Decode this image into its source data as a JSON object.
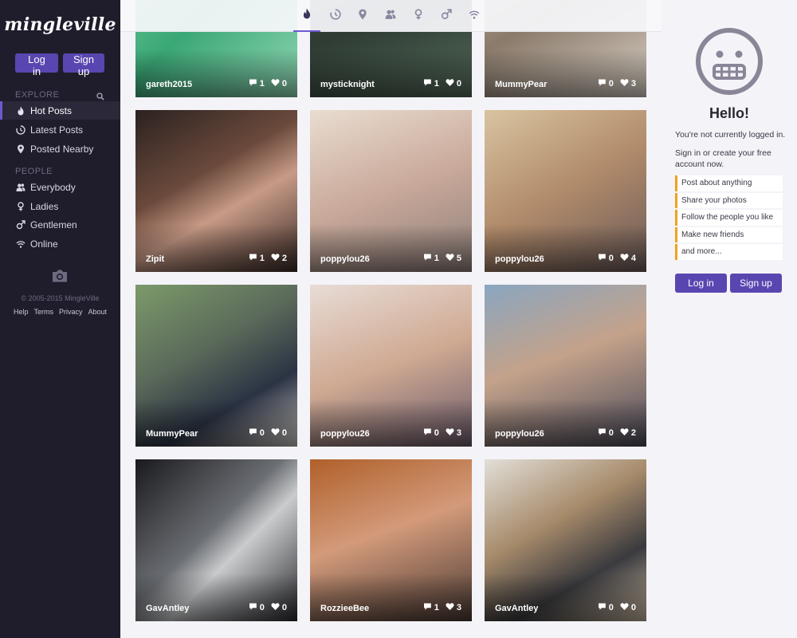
{
  "app": {
    "logo": "mingleville"
  },
  "auth": {
    "login_label": "Log in",
    "signup_label": "Sign up"
  },
  "sidebar": {
    "explore_label": "EXPLORE",
    "explore_items": [
      {
        "label": "Hot Posts",
        "icon": "flame-icon"
      },
      {
        "label": "Latest Posts",
        "icon": "clock-icon"
      },
      {
        "label": "Posted Nearby",
        "icon": "pin-icon"
      }
    ],
    "people_label": "PEOPLE",
    "people_items": [
      {
        "label": "Everybody",
        "icon": "people-icon"
      },
      {
        "label": "Ladies",
        "icon": "female-icon"
      },
      {
        "label": "Gentlemen",
        "icon": "male-icon"
      },
      {
        "label": "Online",
        "icon": "wifi-icon"
      }
    ],
    "copyright": "© 2005-2015 MingleVille",
    "footer_links": [
      "Help",
      "Terms",
      "Privacy",
      "About"
    ]
  },
  "topbar": {
    "tabs": [
      "flame-icon",
      "clock-icon",
      "pin-icon",
      "people-icon",
      "female-icon",
      "male-icon",
      "wifi-icon"
    ],
    "active_tab": "flame-icon"
  },
  "posts": [
    {
      "user": "gareth2015",
      "comments": "1",
      "likes": "0"
    },
    {
      "user": "mysticknight",
      "comments": "1",
      "likes": "0"
    },
    {
      "user": "MummyPear",
      "comments": "0",
      "likes": "3"
    },
    {
      "user": "Zipit",
      "comments": "1",
      "likes": "2"
    },
    {
      "user": "poppylou26",
      "comments": "1",
      "likes": "5"
    },
    {
      "user": "poppylou26",
      "comments": "0",
      "likes": "4"
    },
    {
      "user": "MummyPear",
      "comments": "0",
      "likes": "0"
    },
    {
      "user": "poppylou26",
      "comments": "0",
      "likes": "3"
    },
    {
      "user": "poppylou26",
      "comments": "0",
      "likes": "2"
    },
    {
      "user": "GavAntley",
      "comments": "0",
      "likes": "0"
    },
    {
      "user": "RozzieeBee",
      "comments": "1",
      "likes": "3"
    },
    {
      "user": "GavAntley",
      "comments": "0",
      "likes": "0"
    }
  ],
  "right_panel": {
    "greeting": "Hello!",
    "not_logged": "You're not currently logged in.",
    "sign_in_prompt": "Sign in or create your free account now.",
    "features": [
      "Post about anything",
      "Share your photos",
      "Follow the people you like",
      "Make new friends",
      "and more..."
    ],
    "login_label": "Log in",
    "signup_label": "Sign up"
  },
  "colors": {
    "accent": "#5a46b0",
    "sidebar_bg": "#1f1d2b",
    "feature_border": "#f0a020"
  }
}
